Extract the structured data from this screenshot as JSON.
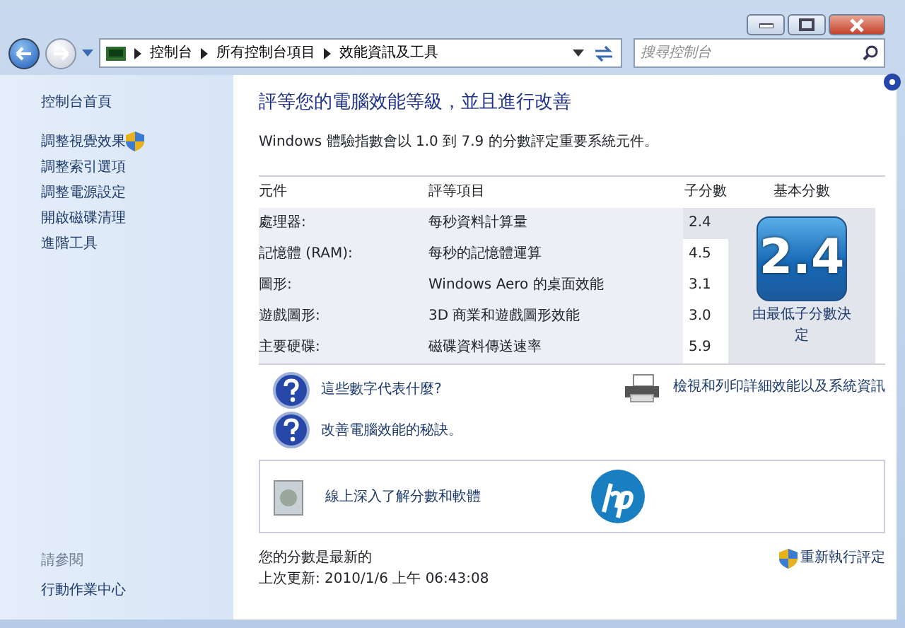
{
  "nav": {
    "breadcrumb": [
      "控制台",
      "所有控制台項目",
      "效能資訊及工具"
    ],
    "search": {
      "placeholder": "搜尋控制台"
    }
  },
  "sidebar": {
    "items": [
      {
        "label": "控制台首頁",
        "kind": "home"
      },
      {
        "label": "調整視覺效果",
        "kind": "shield"
      },
      {
        "label": "調整索引選項",
        "kind": "link"
      },
      {
        "label": "調整電源設定",
        "kind": "link"
      },
      {
        "label": "開啟磁碟清理",
        "kind": "link"
      },
      {
        "label": "進階工具",
        "kind": "link"
      }
    ],
    "see_also": {
      "heading": "請參閱",
      "items": [
        "行動作業中心"
      ]
    }
  },
  "main": {
    "title": "評等您的電腦效能等級，並且進行改善",
    "subtitle": "Windows 體驗指數會以 1.0 到 7.9 的分數評定重要系統元件。",
    "table": {
      "columns": [
        "元件",
        "評等項目",
        "子分數",
        "基本分數"
      ],
      "rows": [
        {
          "component": "處理器:",
          "rating_item": "每秒資料計算量",
          "subscore": "2.4",
          "lowest": true
        },
        {
          "component": "記憶體 (RAM):",
          "rating_item": "每秒的記憶體運算",
          "subscore": "4.5",
          "lowest": false
        },
        {
          "component": "圖形:",
          "rating_item": "Windows Aero 的桌面效能",
          "subscore": "3.1",
          "lowest": false
        },
        {
          "component": "遊戲圖形:",
          "rating_item": "3D 商業和遊戲圖形效能",
          "subscore": "3.0",
          "lowest": false
        },
        {
          "component": "主要硬碟:",
          "rating_item": "磁碟資料傳送速率",
          "subscore": "5.9",
          "lowest": false
        }
      ],
      "base_score": {
        "value": "2.4",
        "caption": "由最低子分數決定"
      }
    },
    "help_links": [
      "這些數字代表什麼?",
      "改善電腦效能的秘訣。"
    ],
    "print_link": "檢視和列印詳細效能以及系統資訊",
    "online_link": "線上深入了解分數和軟體",
    "status": "您的分數是最新的",
    "last_update": "上次更新: 2010/1/6 上午 06:43:08",
    "rerun": "重新執行評定"
  }
}
